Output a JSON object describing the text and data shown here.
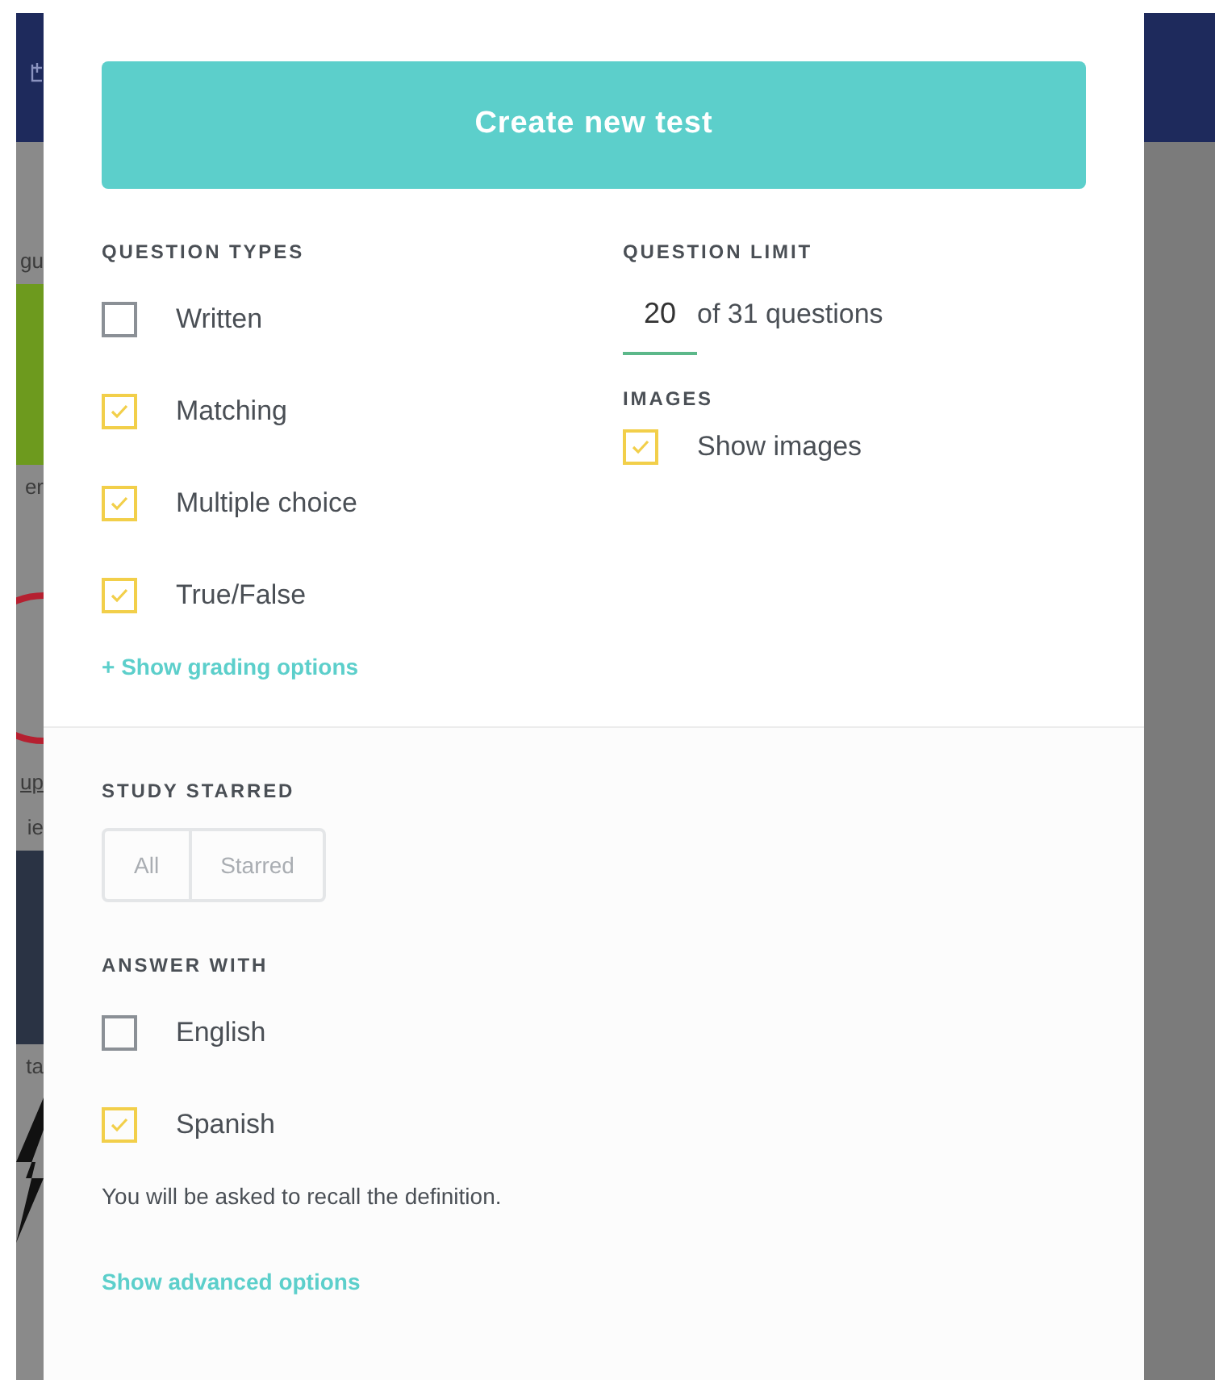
{
  "background_fragments": [
    {
      "text": "gu",
      "kind": "plain"
    },
    {
      "text": "er",
      "kind": "plain"
    },
    {
      "text": "up",
      "kind": "link"
    },
    {
      "text": "ie",
      "kind": "plain"
    },
    {
      "text": "ta",
      "kind": "plain"
    }
  ],
  "create_button": "Create new test",
  "question_types": {
    "title": "QUESTION TYPES",
    "items": [
      {
        "label": "Written",
        "checked": false
      },
      {
        "label": "Matching",
        "checked": true
      },
      {
        "label": "Multiple choice",
        "checked": true
      },
      {
        "label": "True/False",
        "checked": true
      }
    ],
    "link": "+ Show grading options"
  },
  "question_limit": {
    "title": "QUESTION LIMIT",
    "value": "20",
    "suffix": "of 31 questions"
  },
  "images": {
    "title": "IMAGES",
    "items": [
      {
        "label": "Show images",
        "checked": true
      }
    ]
  },
  "study_starred": {
    "title": "STUDY STARRED",
    "disabled": true,
    "options": [
      {
        "label": "All",
        "selected": false
      },
      {
        "label": "Starred",
        "selected": false
      }
    ]
  },
  "answer_with": {
    "title": "ANSWER WITH",
    "items": [
      {
        "label": "English",
        "checked": false
      },
      {
        "label": "Spanish",
        "checked": true
      }
    ],
    "note": "You will be asked to recall the definition."
  },
  "advanced_link": "Show advanced options"
}
